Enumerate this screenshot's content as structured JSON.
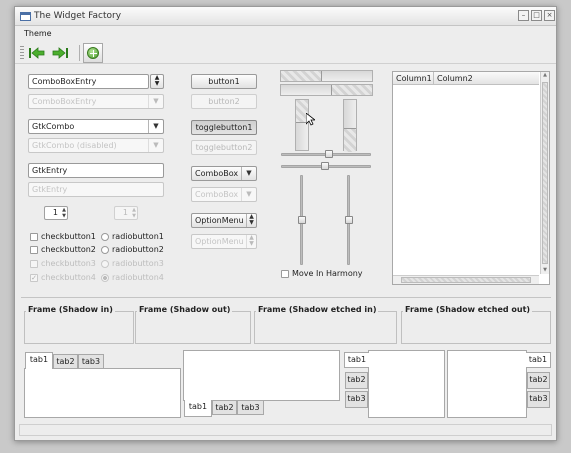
{
  "window": {
    "title": "The Widget Factory"
  },
  "menubar": {
    "items": [
      "Theme"
    ]
  },
  "toolbar": {
    "back_icon": "back-arrow-icon",
    "forward_icon": "forward-arrow-icon",
    "add_icon": "add-icon"
  },
  "col1": {
    "combo_entry": "ComboBoxEntry",
    "combo_entry_disabled": "ComboBoxEntry",
    "gtkcombo": "GtkCombo",
    "gtkcombo_disabled": "GtkCombo (disabled)",
    "entry": "GtkEntry",
    "entry_disabled": "GtkEntry",
    "spin1": "1",
    "spin2": "1",
    "checks": [
      "checkbutton1",
      "checkbutton2",
      "checkbutton3",
      "checkbutton4"
    ],
    "radios": [
      "radiobutton1",
      "radiobutton2",
      "radiobutton3",
      "radiobutton4"
    ]
  },
  "col2": {
    "button1": "button1",
    "button2": "button2",
    "toggle1": "togglebutton1",
    "toggle2": "togglebutton2",
    "combobox1": "ComboBox",
    "combobox2": "ComboBox",
    "optionmenu1": "OptionMenu",
    "optionmenu2": "OptionMenu"
  },
  "col3": {
    "harmony_label": "Move In Harmony"
  },
  "tree": {
    "columns": [
      "Column1",
      "Column2"
    ]
  },
  "frames": [
    "Frame (Shadow in)",
    "Frame (Shadow out)",
    "Frame (Shadow etched in)",
    "Frame (Shadow etched out)"
  ],
  "tabs": [
    "tab1",
    "tab2",
    "tab3"
  ]
}
